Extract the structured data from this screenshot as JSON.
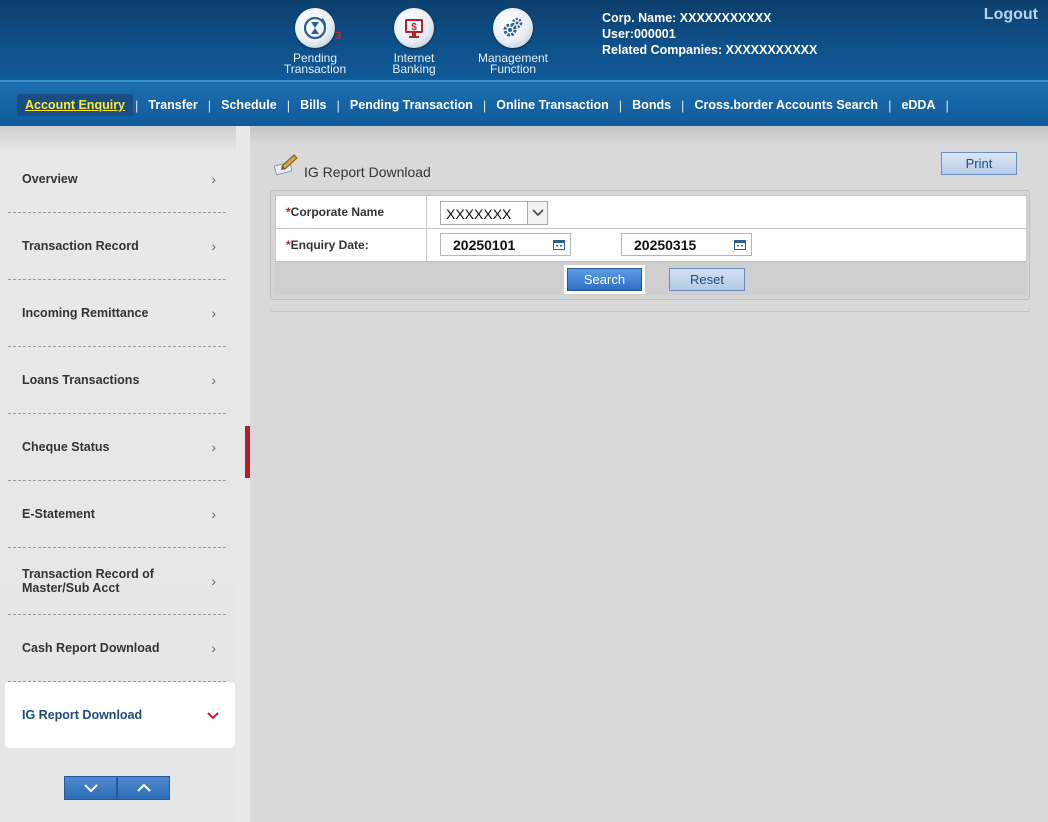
{
  "header": {
    "icons": [
      {
        "name": "pending-transaction",
        "label_line1": "Pending",
        "label_line2": "Transaction",
        "badge": "3"
      },
      {
        "name": "internet-banking",
        "label_line1": "Internet",
        "label_line2": "Banking"
      },
      {
        "name": "management-function",
        "label_line1": "Management",
        "label_line2": "Function"
      }
    ],
    "corp_name": "Corp. Name: XXXXXXXXXXX",
    "user": "User:000001",
    "related_companies": "Related Companies: XXXXXXXXXXX",
    "logout": "Logout"
  },
  "nav": {
    "items": [
      "Account Enquiry",
      "Transfer",
      "Schedule",
      "Bills",
      "Pending Transaction",
      "Online Transaction",
      "Bonds",
      "Cross.border Accounts Search",
      "eDDA"
    ],
    "active": "Account Enquiry"
  },
  "sidebar": {
    "items": [
      {
        "label": "Overview"
      },
      {
        "label": "Transaction Record"
      },
      {
        "label": "Incoming Remittance"
      },
      {
        "label": "Loans Transactions"
      },
      {
        "label": "Cheque Status"
      },
      {
        "label": "E-Statement"
      },
      {
        "label": "Transaction Record of Master/Sub Acct"
      },
      {
        "label": "Cash Report Download"
      },
      {
        "label": "IG Report Download"
      }
    ],
    "active": "IG Report Download"
  },
  "main": {
    "page_title": "IG Report Download",
    "print_label": "Print",
    "form": {
      "corporate_name_label": "Corporate Name",
      "corporate_name_value": "XXXXXXX",
      "enquiry_date_label": "Enquiry Date:",
      "date_from": "20250101",
      "date_to": "20250315",
      "required_mark": "*"
    },
    "search_label": "Search",
    "reset_label": "Reset"
  },
  "colors": {
    "header_blue": "#0f5089",
    "nav_active_text": "#ffea3a",
    "required_red": "#c0202a",
    "button_blue": "#2f6fc4"
  }
}
